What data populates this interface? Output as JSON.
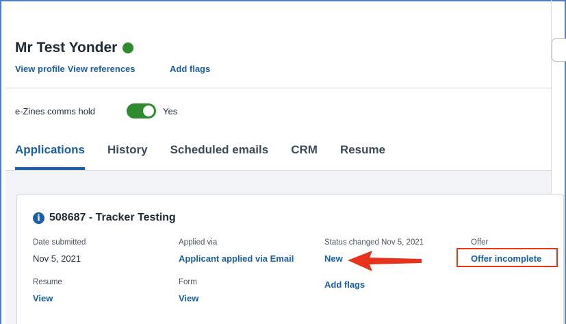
{
  "profile": {
    "name": "Mr Test Yonder",
    "status_color": "#2e8b2e",
    "view_profile": "View profile",
    "view_references": "View references",
    "add_flags": "Add flags"
  },
  "settings": {
    "ezines_label": "e-Zines comms hold",
    "ezines_toggle_on": true,
    "ezines_value": "Yes"
  },
  "tabs": [
    {
      "label": "Applications",
      "active": true
    },
    {
      "label": "History",
      "active": false
    },
    {
      "label": "Scheduled emails",
      "active": false
    },
    {
      "label": "CRM",
      "active": false
    },
    {
      "label": "Resume",
      "active": false
    }
  ],
  "application": {
    "title": "508687 - Tracker Testing",
    "date_submitted_label": "Date submitted",
    "date_submitted": "Nov 5, 2021",
    "applied_via_label": "Applied via",
    "applied_via": "Applicant applied via Email",
    "status_label": "Status changed Nov 5, 2021",
    "status": "New",
    "offer_label": "Offer",
    "offer": "Offer incomplete",
    "resume_label": "Resume",
    "resume_link": "View",
    "form_label": "Form",
    "form_link": "View",
    "add_flags": "Add flags"
  },
  "annotation": {
    "accent_color": "#e8331c"
  }
}
